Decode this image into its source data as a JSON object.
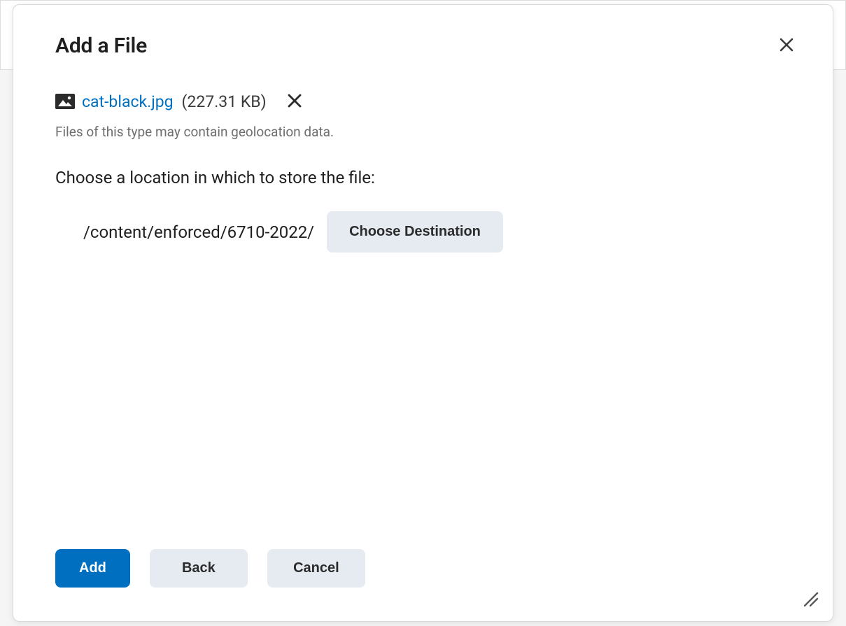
{
  "modal": {
    "title": "Add a File",
    "file": {
      "icon": "image-icon",
      "name": "cat-black.jpg",
      "size": "(227.31 KB)"
    },
    "warning": "Files of this type may contain geolocation data.",
    "location_prompt": "Choose a location in which to store the file:",
    "destination": {
      "path": "/content/enforced/6710-2022/",
      "choose_label": "Choose Destination"
    },
    "footer": {
      "add_label": "Add",
      "back_label": "Back",
      "cancel_label": "Cancel"
    }
  }
}
